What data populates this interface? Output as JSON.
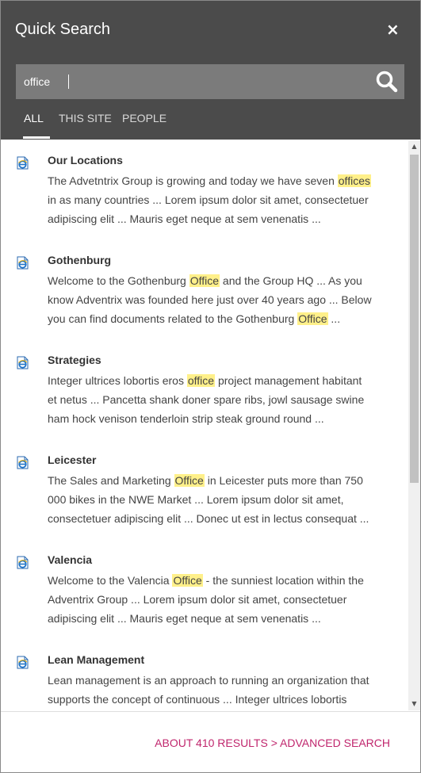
{
  "panel": {
    "title": "Quick Search",
    "close_label": "×"
  },
  "search": {
    "value": "office",
    "placeholder": ""
  },
  "tabs": [
    {
      "label": "ALL",
      "active": true
    },
    {
      "label": "THIS SITE",
      "active": false
    },
    {
      "label": "PEOPLE",
      "active": false
    }
  ],
  "results": [
    {
      "title": "Our Locations",
      "snippet": [
        [
          {
            "t": "The Advetntrix Group is growing and today we have seven "
          },
          {
            "t": "offices",
            "h": true
          }
        ],
        [
          {
            "t": "in as many countries ... Lorem ipsum dolor sit amet, consectetuer"
          }
        ],
        [
          {
            "t": "adipiscing elit ... Mauris eget neque at sem venenatis ..."
          }
        ]
      ]
    },
    {
      "title": "Gothenburg",
      "snippet": [
        [
          {
            "t": "Welcome to the Gothenburg "
          },
          {
            "t": "Office",
            "h": true
          },
          {
            "t": " and the Group HQ ... As you"
          }
        ],
        [
          {
            "t": "know Adventrix was founded here just over 40 years ago ... Below"
          }
        ],
        [
          {
            "t": "you can find documents related to the Gothenburg "
          },
          {
            "t": "Office",
            "h": true
          },
          {
            "t": " ..."
          }
        ]
      ]
    },
    {
      "title": "Strategies",
      "snippet": [
        [
          {
            "t": "Integer ultrices lobortis eros "
          },
          {
            "t": "office",
            "h": true
          },
          {
            "t": " project management habitant"
          }
        ],
        [
          {
            "t": "et netus ... Pancetta shank doner spare ribs, jowl sausage swine"
          }
        ],
        [
          {
            "t": "ham hock venison tenderloin strip steak ground round ..."
          }
        ]
      ]
    },
    {
      "title": "Leicester",
      "snippet": [
        [
          {
            "t": "The Sales and Marketing "
          },
          {
            "t": "Office",
            "h": true
          },
          {
            "t": " in Leicester puts more than 750"
          }
        ],
        [
          {
            "t": "000 bikes in the NWE Market ... Lorem ipsum dolor sit amet,"
          }
        ],
        [
          {
            "t": "consectetuer adipiscing elit ... Donec ut est in lectus consequat ..."
          }
        ]
      ]
    },
    {
      "title": "Valencia",
      "snippet": [
        [
          {
            "t": "Welcome to the Valencia "
          },
          {
            "t": "Office",
            "h": true
          },
          {
            "t": " - the sunniest location within the"
          }
        ],
        [
          {
            "t": "Adventrix Group ... Lorem ipsum dolor sit amet, consectetuer"
          }
        ],
        [
          {
            "t": "adipiscing elit ... Mauris eget neque at sem venenatis ..."
          }
        ]
      ]
    },
    {
      "title": "Lean Management",
      "snippet": [
        [
          {
            "t": "Lean management is an approach to running an organization that"
          }
        ],
        [
          {
            "t": "supports the concept of continuous ... Integer ultrices lobortis"
          }
        ]
      ]
    }
  ],
  "footer": {
    "results_link": "ABOUT 410 RESULTS > ADVANCED SEARCH"
  },
  "colors": {
    "header": "#4b4b4b",
    "search_box": "#7b7b7b",
    "highlight": "#fff08a",
    "link": "#c0266d"
  },
  "icons": {
    "result": "ie-document-icon",
    "search": "search-icon",
    "close": "close-icon"
  }
}
